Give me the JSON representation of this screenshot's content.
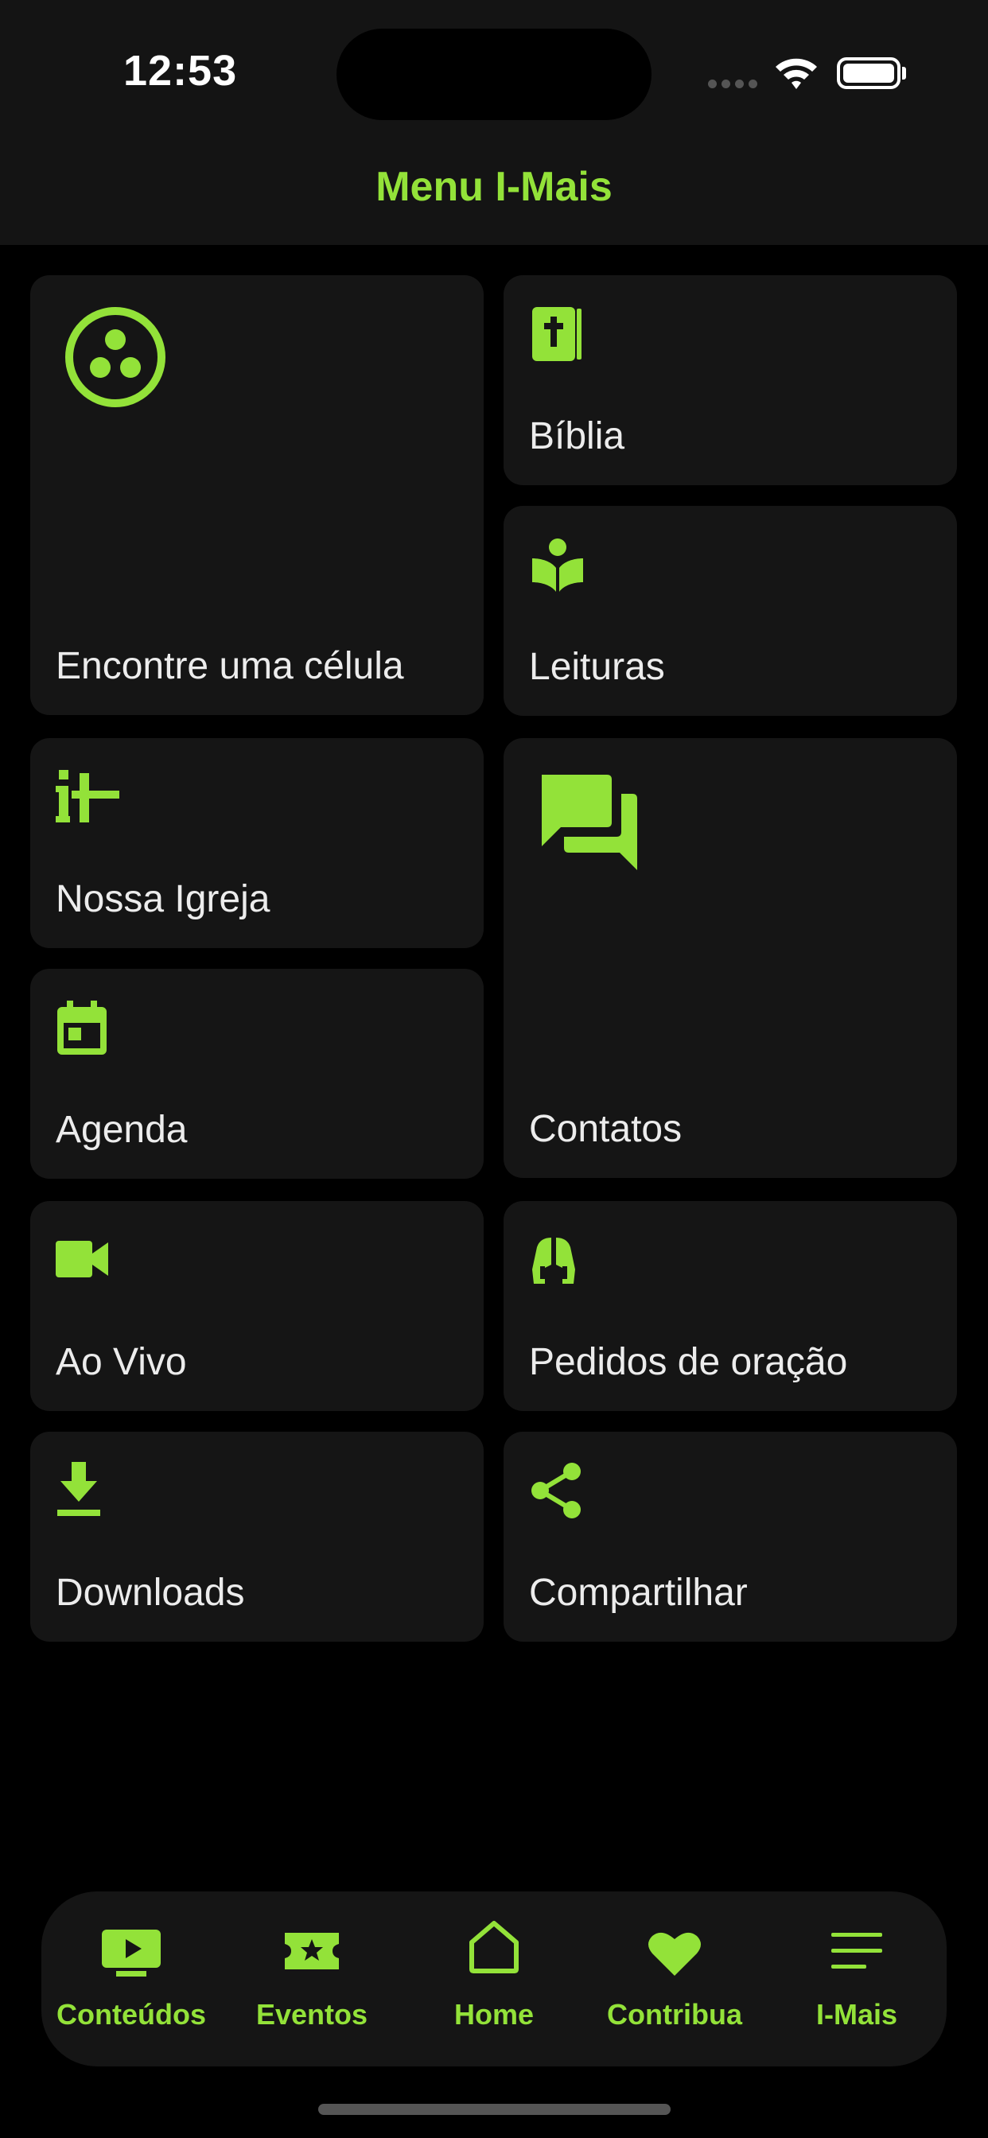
{
  "status": {
    "time": "12:53"
  },
  "header": {
    "title": "Menu I-Mais"
  },
  "colors": {
    "accent": "#93E239",
    "tile": "#151515",
    "background": "#000000",
    "text": "#ECECEC"
  },
  "tiles": [
    {
      "label": "Encontre uma célula",
      "icon": "cell-group-icon"
    },
    {
      "label": "Bíblia",
      "icon": "bible-icon"
    },
    {
      "label": "Leituras",
      "icon": "reading-icon"
    },
    {
      "label": "Nossa Igreja",
      "icon": "church-logo-icon"
    },
    {
      "label": "Contatos",
      "icon": "chat-icon"
    },
    {
      "label": "Agenda",
      "icon": "calendar-icon"
    },
    {
      "label": "Ao Vivo",
      "icon": "video-camera-icon"
    },
    {
      "label": "Pedidos de oração",
      "icon": "praying-hands-icon"
    },
    {
      "label": "Downloads",
      "icon": "download-icon"
    },
    {
      "label": "Compartilhar",
      "icon": "share-icon"
    }
  ],
  "tabbar": {
    "items": [
      {
        "label": "Conteúdos",
        "icon": "play-screen-icon"
      },
      {
        "label": "Eventos",
        "icon": "ticket-star-icon"
      },
      {
        "label": "Home",
        "icon": "home-icon"
      },
      {
        "label": "Contribua",
        "icon": "heart-icon"
      },
      {
        "label": "I-Mais",
        "icon": "menu-icon"
      }
    ]
  }
}
